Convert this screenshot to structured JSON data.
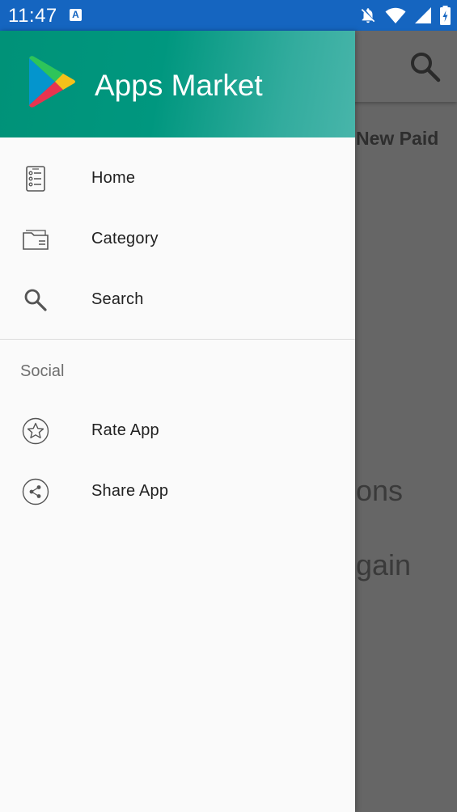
{
  "status_bar": {
    "time": "11:47",
    "indicator_letter": "A",
    "icons": [
      "notifications-off-icon",
      "wifi-icon",
      "signal-icon",
      "battery-charging-icon"
    ]
  },
  "background": {
    "tab_label": "New Paid",
    "body_line1": "ons",
    "body_line2": "gain",
    "toolbar_icon": "search-icon"
  },
  "drawer": {
    "title": "Apps Market",
    "main_items": [
      {
        "label": "Home",
        "icon": "document-list-icon"
      },
      {
        "label": "Category",
        "icon": "folder-icon"
      },
      {
        "label": "Search",
        "icon": "search-icon"
      }
    ],
    "social_header": "Social",
    "social_items": [
      {
        "label": "Rate App",
        "icon": "star-icon"
      },
      {
        "label": "Share App",
        "icon": "share-icon"
      }
    ]
  },
  "colors": {
    "status_bar": "#1565c0",
    "header_gradient_start": "#009278",
    "header_gradient_end": "#48b5aa",
    "scrim": "#666666",
    "drawer_bg": "#fafafa"
  }
}
